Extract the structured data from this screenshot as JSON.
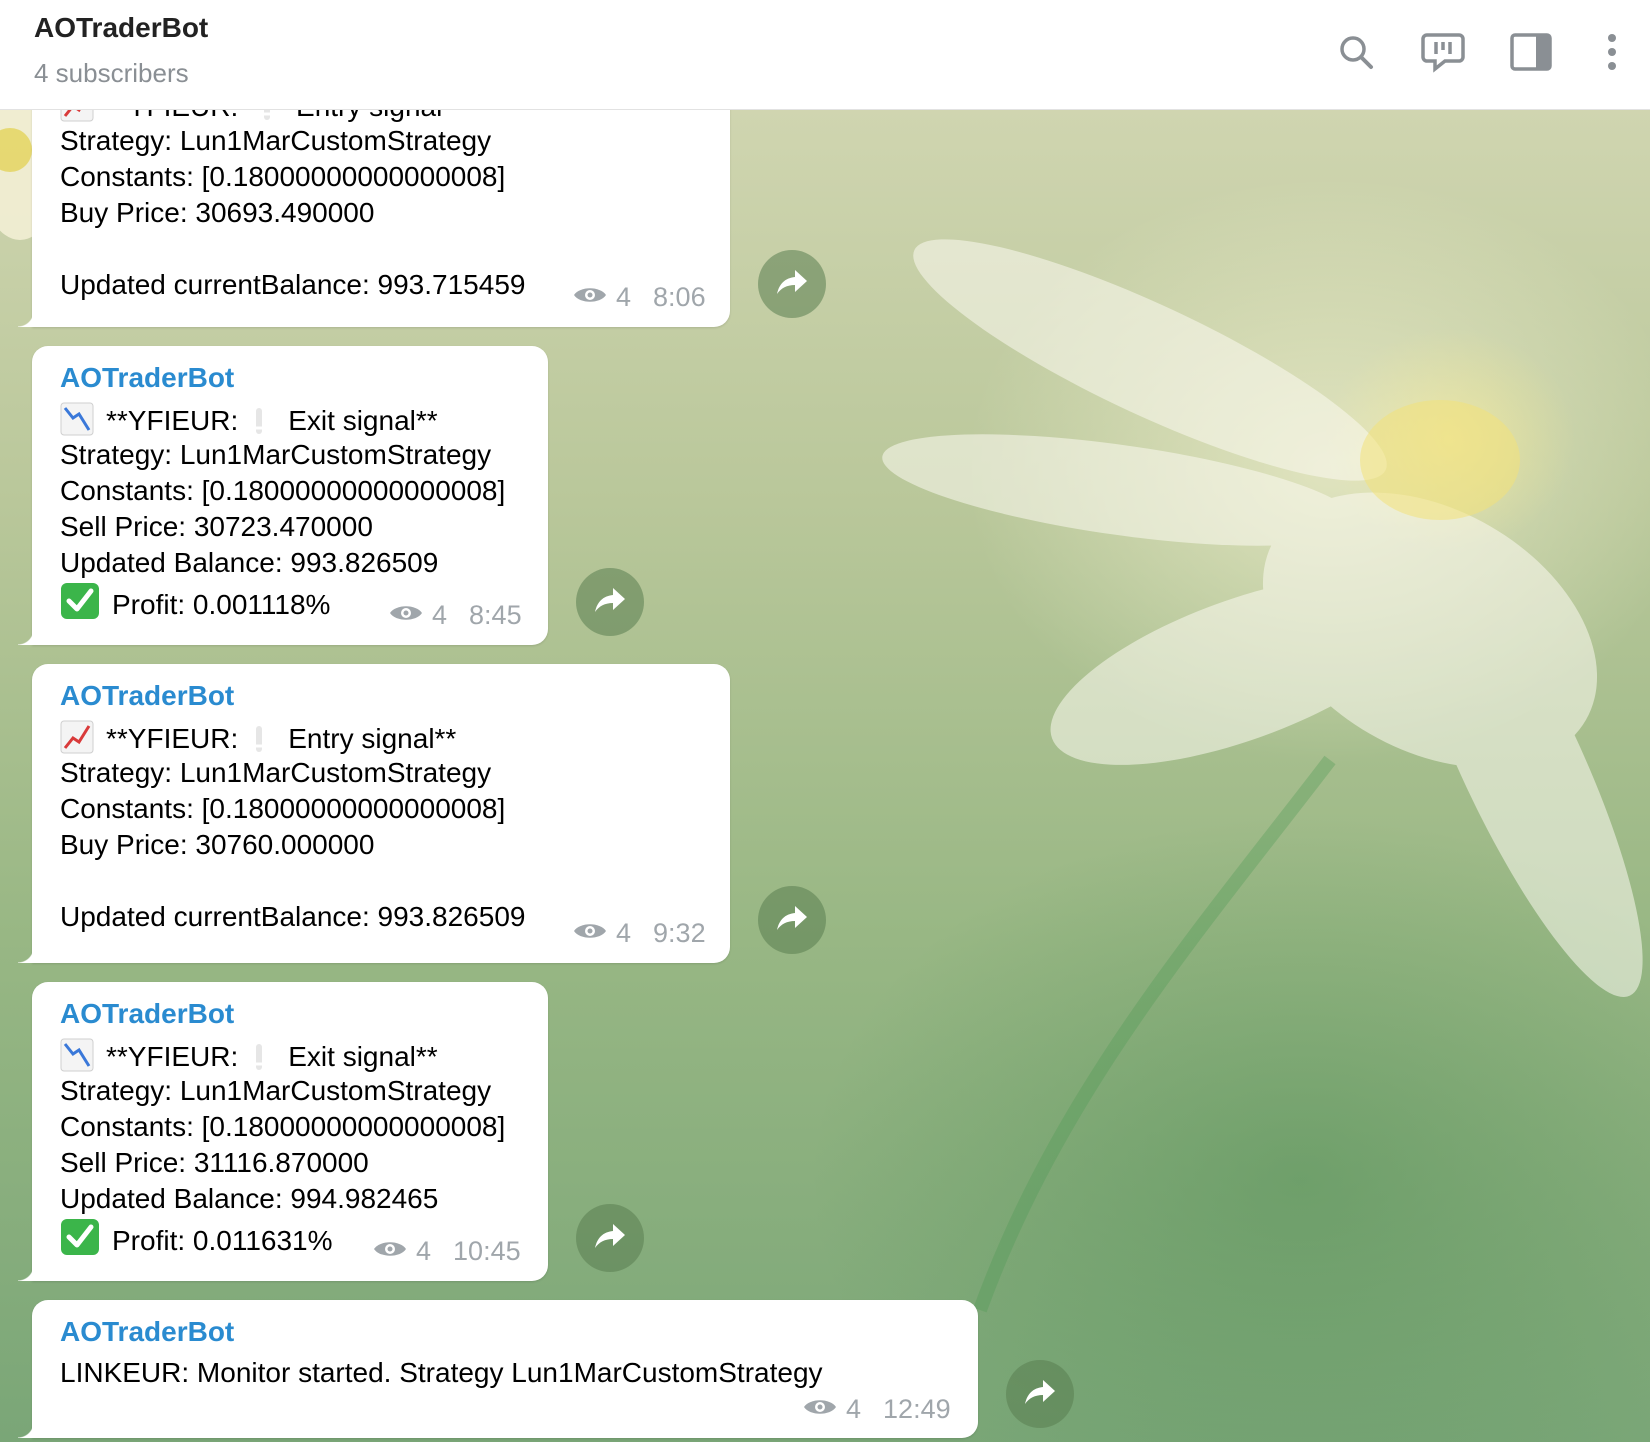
{
  "header": {
    "title": "AOTraderBot",
    "subtitle": "4 subscribers",
    "icons": [
      "search-icon",
      "discussion-icon",
      "sidebar-icon",
      "more-icon"
    ]
  },
  "messages": [
    {
      "sender": "",
      "lines": [
        "**YFIEUR: ",
        "Entry signal**",
        "Strategy: Lun1MarCustomStrategy",
        "Constants: [0.18000000000000008]",
        "Buy Price: 30693.490000",
        "",
        "Updated currentBalance: 993.715459"
      ],
      "views": "4",
      "time": "8:06"
    },
    {
      "sender": "AOTraderBot",
      "title_a": "**YFIEUR:",
      "title_b": "Exit signal**",
      "strategy": "Strategy: Lun1MarCustomStrategy",
      "constants": "Constants: [0.18000000000000008]",
      "price": "Sell Price: 30723.470000",
      "balance": "Updated Balance: 993.826509",
      "profit": "Profit: 0.001118%",
      "views": "4",
      "time": "8:45"
    },
    {
      "sender": "AOTraderBot",
      "title_a": "**YFIEUR:",
      "title_b": "Entry signal**",
      "strategy": "Strategy: Lun1MarCustomStrategy",
      "constants": "Constants: [0.18000000000000008]",
      "price": "Buy Price: 30760.000000",
      "balance": "Updated currentBalance: 993.826509",
      "views": "4",
      "time": "9:32"
    },
    {
      "sender": "AOTraderBot",
      "title_a": "**YFIEUR:",
      "title_b": "Exit signal**",
      "strategy": "Strategy: Lun1MarCustomStrategy",
      "constants": "Constants: [0.18000000000000008]",
      "price": "Sell Price: 31116.870000",
      "balance": "Updated Balance: 994.982465",
      "profit": "Profit: 0.011631%",
      "views": "4",
      "time": "10:45"
    },
    {
      "sender": "AOTraderBot",
      "text": "LINKEUR: Monitor started. Strategy Lun1MarCustomStrategy",
      "views": "4",
      "time": "12:49"
    }
  ],
  "colors": {
    "sender": "#2a8bd0",
    "meta": "#a0a6ab",
    "share_bg": "#6f8f63"
  }
}
